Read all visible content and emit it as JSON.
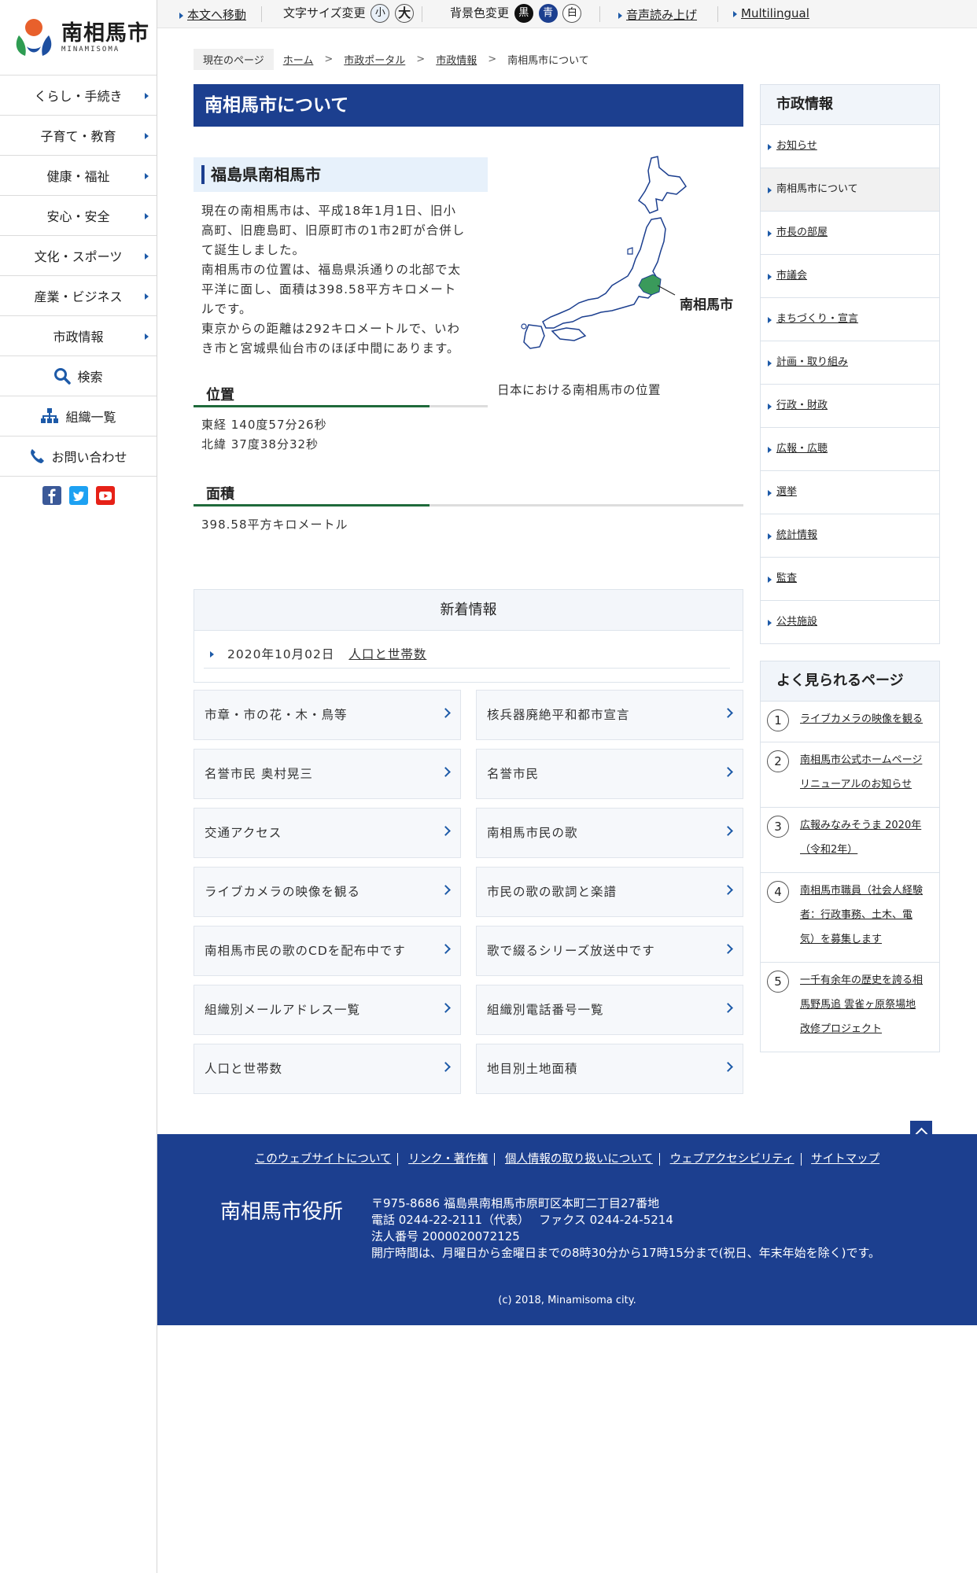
{
  "site": {
    "name": "南相馬市",
    "roman": "MINAMISOMA"
  },
  "topbar": {
    "skip": "本文へ移動",
    "font_size": "文字サイズ変更",
    "font_small": "小",
    "font_large": "大",
    "bg_color": "背景色変更",
    "bg_black": "黒",
    "bg_blue": "青",
    "bg_white": "白",
    "voice": "音声読み上げ",
    "multilingual": "Multilingual"
  },
  "nav": [
    {
      "label": "くらし・手続き"
    },
    {
      "label": "子育て・教育"
    },
    {
      "label": "健康・福祉"
    },
    {
      "label": "安心・安全"
    },
    {
      "label": "文化・スポーツ"
    },
    {
      "label": "産業・ビジネス"
    },
    {
      "label": "市政情報"
    }
  ],
  "utility": {
    "search": "検索",
    "org": "組織一覧",
    "contact": "お問い合わせ"
  },
  "breadcrumb": {
    "here": "現在のページ",
    "home": "ホーム",
    "portal": "市政ポータル",
    "info": "市政情報",
    "current": "南相馬市について"
  },
  "main": {
    "title": "南相馬市について",
    "section_title": "福島県南相馬市",
    "intro": [
      "現在の南相馬市は、平成18年1月1日、旧小",
      "高町、旧鹿島町、旧原町市の1市2町が合併し",
      "て誕生しました。",
      "南相馬市の位置は、福島県浜通りの北部で太",
      "平洋に面し、面積は398.58平方キロメート",
      "ルです。",
      "東京からの距離は292キロメートルで、いわ",
      "き市と宮城県仙台市のほぼ中間にあります。"
    ],
    "position_title": "位置",
    "longitude": "東経 140度57分26秒",
    "latitude": "北緯 37度38分32秒",
    "area_title": "面積",
    "area": "398.58平方キロメートル",
    "map_label": "南相馬市",
    "map_caption": "日本における南相馬市の位置"
  },
  "news": {
    "title": "新着情報",
    "items": [
      {
        "date": "2020年10月02日",
        "title": "人口と世帯数"
      }
    ]
  },
  "links": [
    "市章・市の花・木・鳥等",
    "核兵器廃絶平和都市宣言",
    "名誉市民 奥村晃三",
    "名誉市民",
    "交通アクセス",
    "南相馬市民の歌",
    "ライブカメラの映像を観る",
    "市民の歌の歌詞と楽譜",
    "南相馬市民の歌のCDを配布中です",
    "歌で綴るシリーズ放送中です",
    "組織別メールアドレス一覧",
    "組織別電話番号一覧",
    "人口と世帯数",
    "地目別土地面積"
  ],
  "side": {
    "title": "市政情報",
    "items": [
      "お知らせ",
      "南相馬市について",
      "市長の部屋",
      "市議会",
      "まちづくり・宣言",
      "計画・取り組み",
      "行政・財政",
      "広報・広聴",
      "選挙",
      "統計情報",
      "監査",
      "公共施設"
    ]
  },
  "popular": {
    "title": "よく見られるページ",
    "items": [
      {
        "num": "1",
        "lines": [
          "ライブカメラの映像を観る"
        ]
      },
      {
        "num": "2",
        "lines": [
          "南相馬市公式ホームページ",
          "リニューアルのお知らせ"
        ]
      },
      {
        "num": "3",
        "lines": [
          "広報みなみそうま 2020年",
          "（令和2年）"
        ]
      },
      {
        "num": "4",
        "lines": [
          "南相馬市職員（社会人経験",
          "者：行政事務、土木、電",
          "気）を募集します"
        ]
      },
      {
        "num": "5",
        "lines": [
          "一千有余年の歴史を誇る相",
          "馬野馬追 雲雀ヶ原祭場地",
          "改修プロジェクト"
        ]
      }
    ]
  },
  "footer": {
    "links": [
      "このウェブサイトについて",
      "リンク・著作権",
      "個人情報の取り扱いについて",
      "ウェブアクセシビリティ",
      "サイトマップ"
    ],
    "org": "南相馬市役所",
    "address": "〒975-8686 福島県南相馬市原町区本町二丁目27番地",
    "tel": "電話 0244-22-2111（代表）　 ファクス 0244-24-5214",
    "corp": "法人番号 2000020072125",
    "hours": "開庁時間は、月曜日から金曜日までの8時30分から17時15分まで(祝日、年末年始を除く)です。",
    "copyright": "(c) 2018, Minamisoma city."
  },
  "colors": {
    "brand_blue": "#1c3f8f",
    "accent_green": "#1f6a3b",
    "map_highlight": "#3a9a5b",
    "logo_orange": "#e8602c",
    "logo_blue": "#1d4fa0",
    "logo_green": "#2e9c52"
  }
}
